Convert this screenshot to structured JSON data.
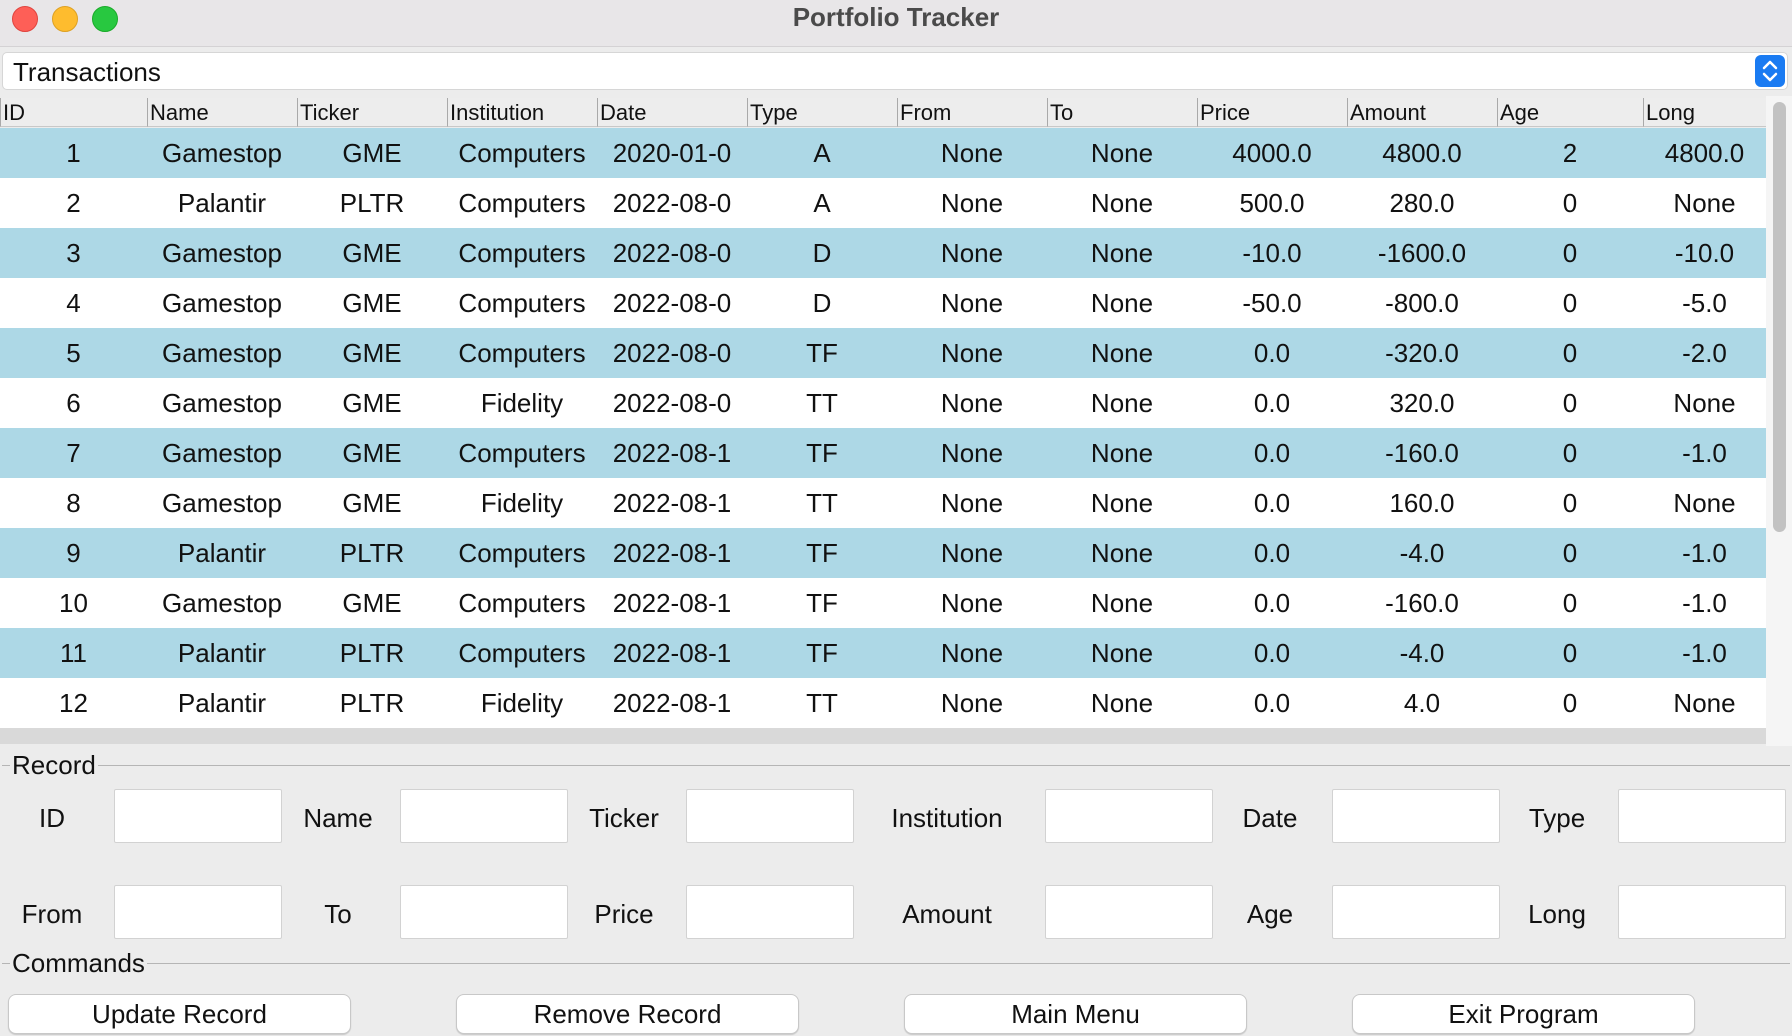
{
  "window": {
    "title": "Portfolio Tracker"
  },
  "view_select": {
    "value": "Transactions"
  },
  "table": {
    "columns": [
      "ID",
      "Name",
      "Ticker",
      "Institution",
      "Date",
      "Type",
      "From",
      "To",
      "Price",
      "Amount",
      "Age",
      "Long"
    ],
    "rows": [
      [
        "1",
        "Gamestop",
        "GME",
        "Computers",
        "2020-01-0",
        "A",
        "None",
        "None",
        "4000.0",
        "4800.0",
        "2",
        "4800.0"
      ],
      [
        "2",
        "Palantir",
        "PLTR",
        "Computers",
        "2022-08-0",
        "A",
        "None",
        "None",
        "500.0",
        "280.0",
        "0",
        "None"
      ],
      [
        "3",
        "Gamestop",
        "GME",
        "Computers",
        "2022-08-0",
        "D",
        "None",
        "None",
        "-10.0",
        "-1600.0",
        "0",
        "-10.0"
      ],
      [
        "4",
        "Gamestop",
        "GME",
        "Computers",
        "2022-08-0",
        "D",
        "None",
        "None",
        "-50.0",
        "-800.0",
        "0",
        "-5.0"
      ],
      [
        "5",
        "Gamestop",
        "GME",
        "Computers",
        "2022-08-0",
        "TF",
        "None",
        "None",
        "0.0",
        "-320.0",
        "0",
        "-2.0"
      ],
      [
        "6",
        "Gamestop",
        "GME",
        "Fidelity",
        "2022-08-0",
        "TT",
        "None",
        "None",
        "0.0",
        "320.0",
        "0",
        "None"
      ],
      [
        "7",
        "Gamestop",
        "GME",
        "Computers",
        "2022-08-1",
        "TF",
        "None",
        "None",
        "0.0",
        "-160.0",
        "0",
        "-1.0"
      ],
      [
        "8",
        "Gamestop",
        "GME",
        "Fidelity",
        "2022-08-1",
        "TT",
        "None",
        "None",
        "0.0",
        "160.0",
        "0",
        "None"
      ],
      [
        "9",
        "Palantir",
        "PLTR",
        "Computers",
        "2022-08-1",
        "TF",
        "None",
        "None",
        "0.0",
        "-4.0",
        "0",
        "-1.0"
      ],
      [
        "10",
        "Gamestop",
        "GME",
        "Computers",
        "2022-08-1",
        "TF",
        "None",
        "None",
        "0.0",
        "-160.0",
        "0",
        "-1.0"
      ],
      [
        "11",
        "Palantir",
        "PLTR",
        "Computers",
        "2022-08-1",
        "TF",
        "None",
        "None",
        "0.0",
        "-4.0",
        "0",
        "-1.0"
      ],
      [
        "12",
        "Palantir",
        "PLTR",
        "Fidelity",
        "2022-08-1",
        "TT",
        "None",
        "None",
        "0.0",
        "4.0",
        "0",
        "None"
      ]
    ]
  },
  "record": {
    "label": "Record",
    "fields": [
      {
        "label": "ID",
        "value": ""
      },
      {
        "label": "Name",
        "value": ""
      },
      {
        "label": "Ticker",
        "value": ""
      },
      {
        "label": "Institution",
        "value": ""
      },
      {
        "label": "Date",
        "value": ""
      },
      {
        "label": "Type",
        "value": ""
      },
      {
        "label": "From",
        "value": ""
      },
      {
        "label": "To",
        "value": ""
      },
      {
        "label": "Price",
        "value": ""
      },
      {
        "label": "Amount",
        "value": ""
      },
      {
        "label": "Age",
        "value": ""
      },
      {
        "label": "Long",
        "value": ""
      }
    ]
  },
  "commands": {
    "label": "Commands",
    "buttons": [
      "Update Record",
      "Remove Record",
      "Main Menu",
      "Exit Program"
    ]
  },
  "colors": {
    "row_highlight": "#add8e6",
    "row_plain": "#ffffff",
    "combo_accent": "#1a7bf2"
  }
}
